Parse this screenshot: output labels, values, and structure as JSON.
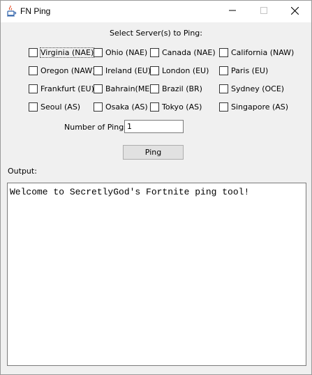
{
  "window": {
    "title": "FN Ping",
    "app_icon": "java-app-icon",
    "controls": {
      "minimize": "minimize-icon",
      "maximize": "maximize-icon",
      "close": "close-icon"
    }
  },
  "heading": "Select Server(s) to Ping:",
  "servers": [
    {
      "label": "Virginia (NAE)",
      "checked": false,
      "focused": true
    },
    {
      "label": "Ohio (NAE)",
      "checked": false
    },
    {
      "label": "Canada (NAE)",
      "checked": false
    },
    {
      "label": "California (NAW)",
      "checked": false
    },
    {
      "label": "Oregon (NAW)",
      "checked": false
    },
    {
      "label": "Ireland (EU)",
      "checked": false
    },
    {
      "label": "London (EU)",
      "checked": false
    },
    {
      "label": "Paris (EU)",
      "checked": false
    },
    {
      "label": "Frankfurt (EU)",
      "checked": false
    },
    {
      "label": "Bahrain(ME)",
      "checked": false
    },
    {
      "label": "Brazil (BR)",
      "checked": false
    },
    {
      "label": "Sydney (OCE)",
      "checked": false
    },
    {
      "label": "Seoul (AS)",
      "checked": false
    },
    {
      "label": "Osaka (AS)",
      "checked": false
    },
    {
      "label": "Tokyo (AS)",
      "checked": false
    },
    {
      "label": "Singapore (AS)",
      "checked": false
    }
  ],
  "pings": {
    "label": "Number of Pings:",
    "value": "1"
  },
  "ping_button": "Ping",
  "output": {
    "label": "Output:",
    "text": "Welcome to SecretlyGod's Fortnite ping tool!"
  }
}
